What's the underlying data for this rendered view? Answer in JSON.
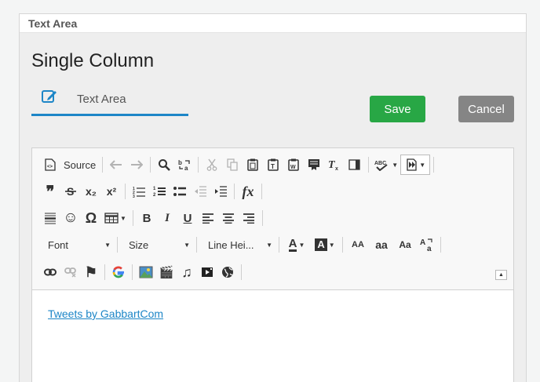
{
  "panel": {
    "title": "Text Area"
  },
  "page": {
    "heading": "Single Column"
  },
  "tab": {
    "label": "Text Area",
    "icon": "edit-icon"
  },
  "buttons": {
    "save": "Save",
    "cancel": "Cancel"
  },
  "colors": {
    "accent": "#1d86c7",
    "save": "#28a745",
    "cancel": "#858585"
  },
  "toolbar": {
    "source": "Source",
    "combos": {
      "font": "Font",
      "size": "Size",
      "line_height": "Line Hei..."
    },
    "glyphs": {
      "blockquote": "❞",
      "strike": "S",
      "subscript": "x₂",
      "superscript": "x²",
      "emoji": "☺",
      "omega": "Ω",
      "bold": "B",
      "italic": "I",
      "underline": "U",
      "remove_format": "Tx",
      "function": "fx",
      "font_color": "A",
      "bg_color": "A",
      "case_upper": "AA",
      "case_lower": "aa",
      "case_title": "Aa",
      "film": "🎬",
      "music": "♫",
      "flag": "⚑"
    }
  },
  "content": {
    "link_text": "Tweets by GabbartCom"
  }
}
